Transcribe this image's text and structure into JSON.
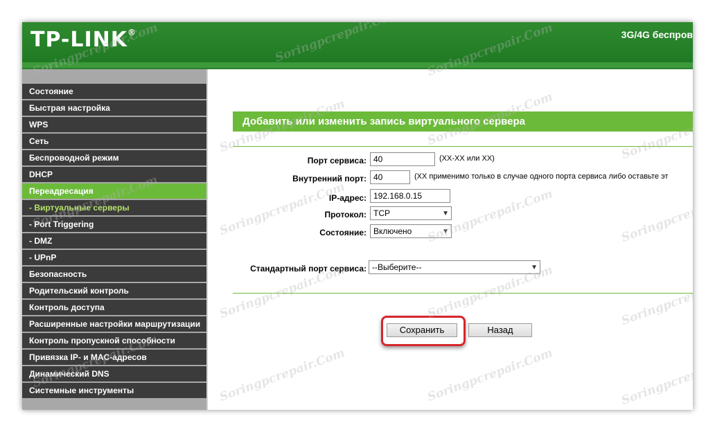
{
  "header": {
    "logo": "TP-LINK",
    "logo_mark": "®",
    "model_title": "3G/4G беспров"
  },
  "sidebar": {
    "items": [
      {
        "label": "Состояние"
      },
      {
        "label": "Быстрая настройка"
      },
      {
        "label": "WPS"
      },
      {
        "label": "Сеть"
      },
      {
        "label": "Беспроводной режим"
      },
      {
        "label": "DHCP"
      },
      {
        "label": "Переадресация"
      },
      {
        "label": "- Виртуальные серверы"
      },
      {
        "label": "- Port Triggering"
      },
      {
        "label": "- DMZ"
      },
      {
        "label": "- UPnP"
      },
      {
        "label": "Безопасность"
      },
      {
        "label": "Родительский контроль"
      },
      {
        "label": "Контроль доступа"
      },
      {
        "label": "Расширенные настройки маршрутизации"
      },
      {
        "label": "Контроль пропускной способности"
      },
      {
        "label": "Привязка IP- и MAC-адресов"
      },
      {
        "label": "Динамический DNS"
      },
      {
        "label": "Системные инструменты"
      }
    ]
  },
  "form": {
    "title": "Добавить или изменить запись виртуального сервера",
    "service_port": {
      "label": "Порт сервиса:",
      "value": "40",
      "hint": "(XX-XX или XX)"
    },
    "internal_port": {
      "label": "Внутренний порт:",
      "value": "40",
      "hint": "(XX применимо только в случае одного порта сервиса либо оставьте эт"
    },
    "ip_address": {
      "label": "IP-адрес:",
      "value": "192.168.0.15"
    },
    "protocol": {
      "label": "Протокол:",
      "value": "TCP"
    },
    "status": {
      "label": "Состояние:",
      "value": "Включено"
    },
    "common_port": {
      "label": "Стандартный порт сервиса:",
      "value": "--Выберите--"
    },
    "save_label": "Сохранить",
    "back_label": "Назад"
  },
  "watermark": "Soringpcrepair.Com",
  "colors": {
    "accent_green": "#6cba3a",
    "header_green": "#2a852a",
    "menu_dark": "#3b3b3b",
    "highlight_red": "#d6262b"
  }
}
